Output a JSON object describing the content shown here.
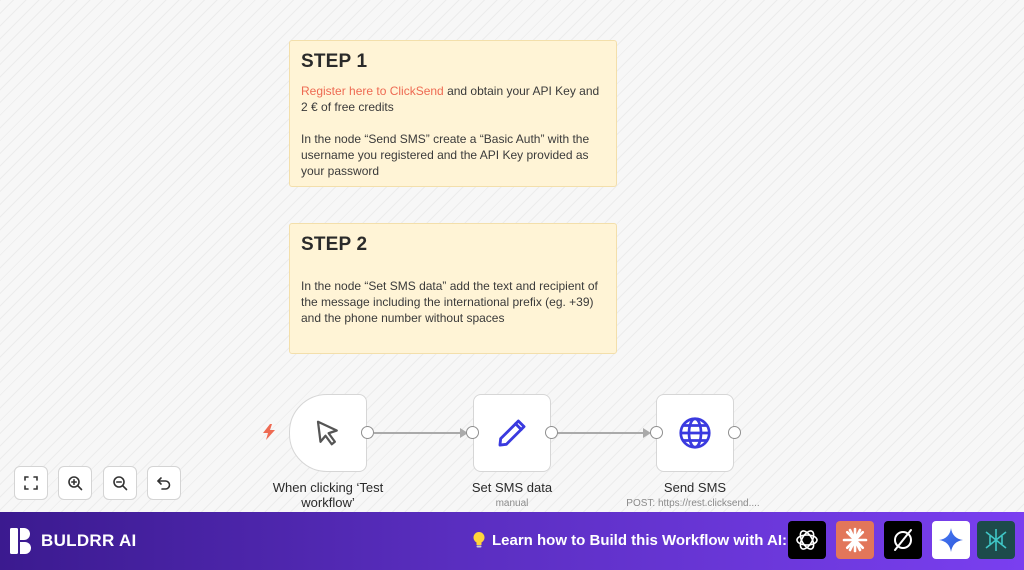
{
  "notes": [
    {
      "title": "STEP 1",
      "link_text": "Register here to ClickSend",
      "line1_rest": " and obtain your API Key and 2 € of free credits",
      "paragraph2": "In the node “Send SMS” create a “Basic Auth” with the username you registered and the API Key provided as your password"
    },
    {
      "title": "STEP 2",
      "paragraph": "In the node “Set SMS data” add the text and recipient of the message including the international prefix (eg. +39) and the phone number without spaces"
    }
  ],
  "nodes": [
    {
      "label": "When clicking ‘Test workflow’",
      "subtitle": "",
      "icon": "cursor-icon"
    },
    {
      "label": "Set SMS data",
      "subtitle": "manual",
      "icon": "pencil-icon"
    },
    {
      "label": "Send SMS",
      "subtitle": "POST: https://rest.clicksend....",
      "icon": "globe-icon"
    }
  ],
  "controls": [
    "fit-view-icon",
    "zoom-in-icon",
    "zoom-out-icon",
    "undo-icon"
  ],
  "banner": {
    "brand": "BULDRR AI",
    "cta": "Learn how to Build this Workflow with AI:",
    "ai_icons": [
      "chatgpt-icon",
      "claude-icon",
      "perplexity-icon",
      "gemini-icon",
      "deepseek-icon"
    ]
  },
  "colors": {
    "accent": "#ee6a52",
    "node_icon": "#3a3adf",
    "note_bg": "#fff4d6",
    "banner_start": "#3b1a8f",
    "banner_end": "#7a3ff0"
  }
}
